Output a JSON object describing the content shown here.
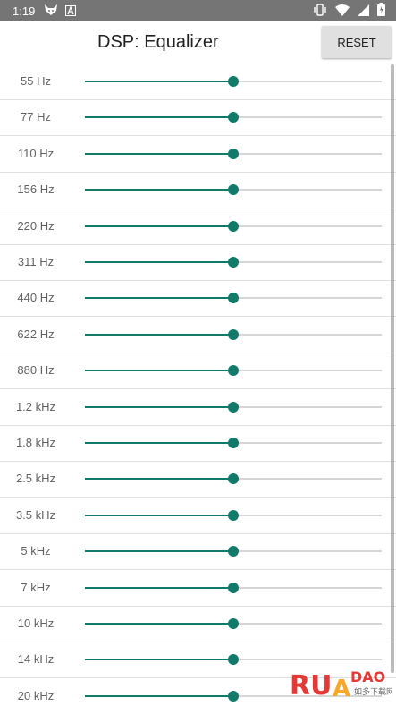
{
  "status_bar": {
    "time": "1:19"
  },
  "header": {
    "title": "DSP: Equalizer",
    "reset_label": "RESET"
  },
  "colors": {
    "accent": "#117a6b",
    "track": "#d6d6d6",
    "status_bar": "#757575",
    "button": "#e0e0e0"
  },
  "equalizer": {
    "bands": [
      {
        "label": "55 Hz",
        "value": 0.5
      },
      {
        "label": "77 Hz",
        "value": 0.5
      },
      {
        "label": "110 Hz",
        "value": 0.5
      },
      {
        "label": "156 Hz",
        "value": 0.5
      },
      {
        "label": "220 Hz",
        "value": 0.5
      },
      {
        "label": "311 Hz",
        "value": 0.5
      },
      {
        "label": "440 Hz",
        "value": 0.5
      },
      {
        "label": "622 Hz",
        "value": 0.5
      },
      {
        "label": "880 Hz",
        "value": 0.5
      },
      {
        "label": "1.2 kHz",
        "value": 0.5
      },
      {
        "label": "1.8 kHz",
        "value": 0.5
      },
      {
        "label": "2.5 kHz",
        "value": 0.5
      },
      {
        "label": "3.5 kHz",
        "value": 0.5
      },
      {
        "label": "5 kHz",
        "value": 0.5
      },
      {
        "label": "7 kHz",
        "value": 0.5
      },
      {
        "label": "10 kHz",
        "value": 0.5
      },
      {
        "label": "14 kHz",
        "value": 0.5
      },
      {
        "label": "20 kHz",
        "value": 0.5
      }
    ]
  },
  "watermark": {
    "brand": "RUANDAO",
    "sub": "如多下载网"
  }
}
